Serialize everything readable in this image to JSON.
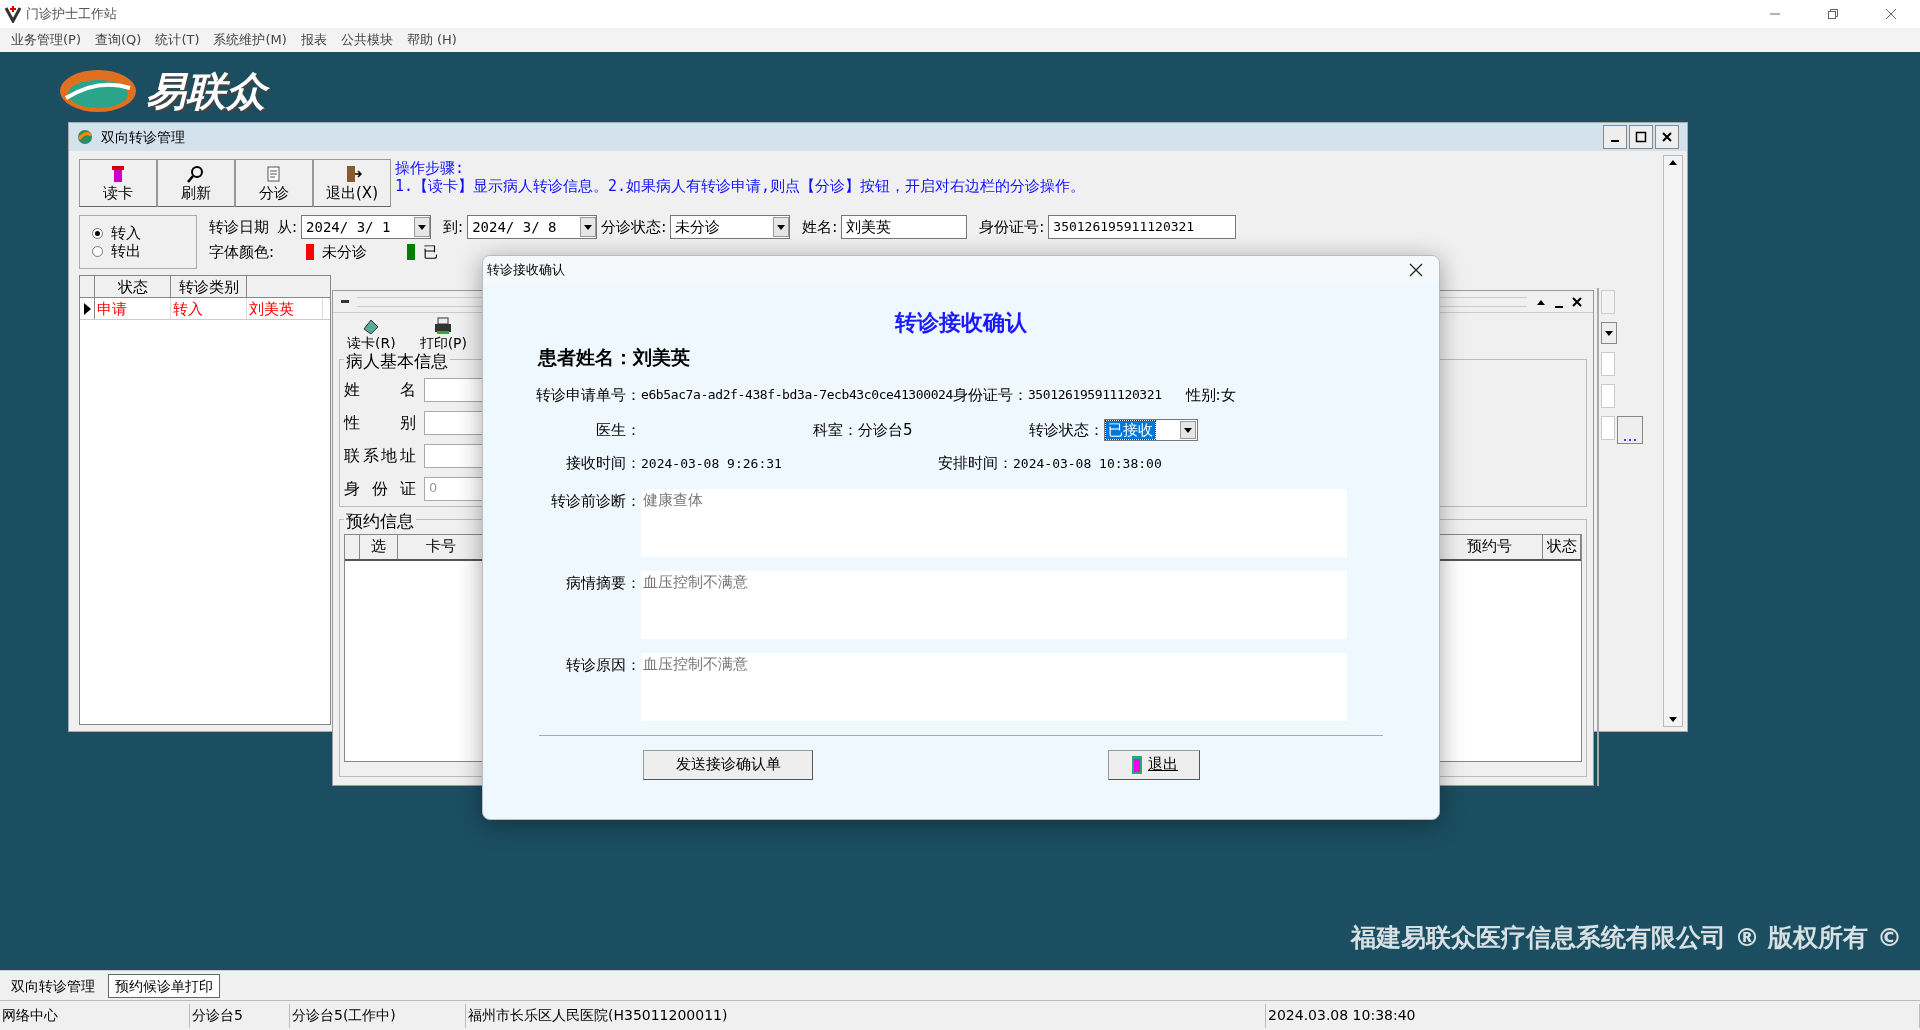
{
  "app": {
    "title": "门诊护士工作站"
  },
  "menu": [
    "业务管理(P)",
    "查询(Q)",
    "统计(T)",
    "系统维护(M)",
    "报表",
    "公共模块",
    "帮助 (H)"
  ],
  "logo": {
    "text": "易联众"
  },
  "referral_window": {
    "title": "双向转诊管理",
    "toolbar": [
      "读卡",
      "刷新",
      "分诊",
      "退出(X)"
    ],
    "instructions": [
      "操作步骤:",
      "1.【读卡】显示病人转诊信息。2.如果病人有转诊申请,则点【分诊】按钮，开启对右边栏的分诊操作。"
    ],
    "direction": [
      {
        "label": "转入",
        "selected": true
      },
      {
        "label": "转出",
        "selected": false
      }
    ],
    "filters": {
      "date_label": "转诊日期",
      "from_label": "从:",
      "from": "2024/ 3/ 1",
      "to_label": "到:",
      "to": "2024/ 3/ 8",
      "status_label": "分诊状态:",
      "status": "未分诊",
      "name_label": "姓名:",
      "name": "刘美英",
      "id_label": "身份证号:",
      "id": "350126195911120321"
    },
    "legend": {
      "label": "字体颜色:",
      "items": [
        {
          "label": "未分诊",
          "color": "#ff0000"
        },
        {
          "label": "已",
          "color": "#008000"
        }
      ]
    },
    "list": {
      "columns": [
        "状态",
        "转诊类别"
      ],
      "rows": [
        {
          "cells": [
            "申请",
            "转入",
            "刘美英"
          ],
          "selected": true,
          "color": "#ff0000"
        }
      ]
    }
  },
  "triage_panel": {
    "toolbar": [
      "读卡(R)",
      "打印(P)"
    ],
    "basic_info": {
      "title": "病人基本信息",
      "fields": [
        {
          "label": "姓 名"
        },
        {
          "label": "性 别"
        },
        {
          "label": "联系地址"
        },
        {
          "label": "身 份 证",
          "value": "0"
        }
      ]
    },
    "appointments": {
      "title": "预约信息",
      "left_columns": [
        "选",
        "卡号"
      ],
      "right_columns": [
        "预约号",
        "状态"
      ]
    }
  },
  "dialog": {
    "title": "转诊接收确认",
    "heading": "转诊接收确认",
    "patient_label": "患者姓名：",
    "patient_name": "刘美英",
    "request_no_label": "转诊申请单号：",
    "request_no": "e6b5ac7a-ad2f-438f-bd3a-7ecb43c0ce41300024",
    "id_label": "身份证号：",
    "id": "350126195911120321",
    "gender": "性别:女",
    "doctor_label": "医生：",
    "dept_label": "科室：",
    "dept": "分诊台5",
    "status_label": "转诊状态：",
    "status": "已接收",
    "received_label": "接收时间：",
    "received": "2024-03-08 9:26:31",
    "scheduled_label": "安排时间：",
    "scheduled": "2024-03-08 10:38:00",
    "notes": [
      {
        "label": "转诊前诊断：",
        "value": "健康查体"
      },
      {
        "label": "病情摘要：",
        "value": "血压控制不满意"
      },
      {
        "label": "转诊原因：",
        "value": "血压控制不满意"
      }
    ],
    "buttons": [
      {
        "label": "发送接诊确认单",
        "kind": "plain"
      },
      {
        "label": "退出",
        "kind": "exit"
      }
    ]
  },
  "copyright": "福建易联众医疗信息系统有限公司 ® 版权所有 ©",
  "window_tabs": [
    {
      "label": "双向转诊管理",
      "selected": false
    },
    {
      "label": "预约候诊单打印",
      "selected": true
    }
  ],
  "status_bar": [
    "网络中心",
    "分诊台5",
    "分诊台5(工作中)",
    "福州市长乐区人民医院(H35011200011)",
    "2024.03.08 10:38:40"
  ]
}
